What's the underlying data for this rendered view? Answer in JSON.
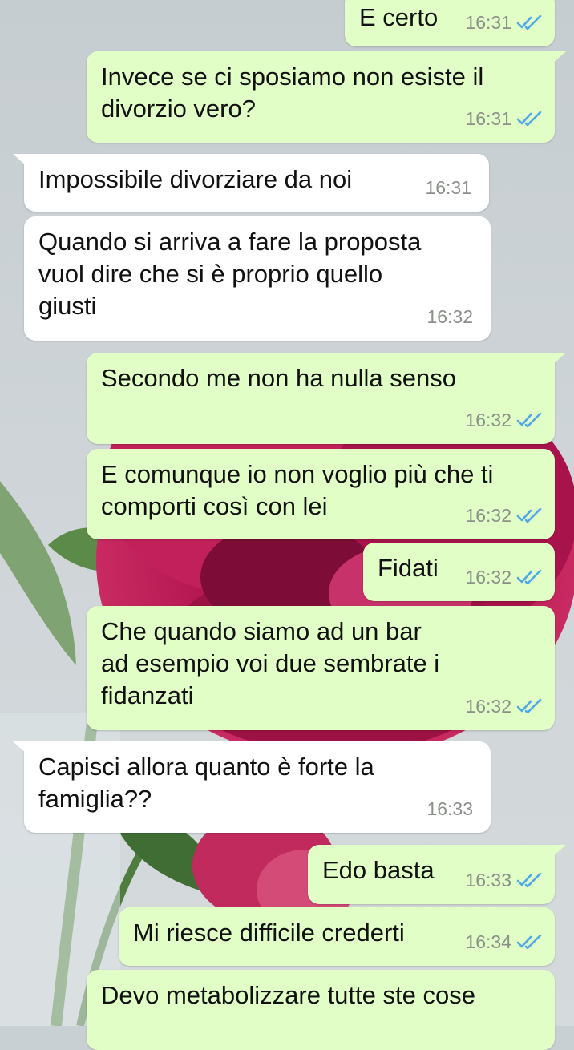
{
  "colors": {
    "outgoing_bubble": "#e1fec6",
    "incoming_bubble": "#ffffff",
    "read_ticks": "#4fa8e8",
    "time_text": "#8a8f8a"
  },
  "icons": {
    "read_receipt": "double-check-icon"
  },
  "messages": [
    {
      "direction": "out",
      "text": "E certo",
      "time": "16:31",
      "read": true
    },
    {
      "direction": "out",
      "text": "Invece se ci sposiamo non esiste il\ndivorzio vero?",
      "time": "16:31",
      "read": true
    },
    {
      "direction": "in",
      "text": "Impossibile divorziare da noi",
      "time": "16:31"
    },
    {
      "direction": "in",
      "text": "Quando si arriva a fare la proposta\nvuol dire che si è proprio quello\ngiusti",
      "time": "16:32"
    },
    {
      "direction": "out",
      "text": "Secondo me non ha nulla senso",
      "time": "16:32",
      "read": true
    },
    {
      "direction": "out",
      "text": "E comunque io non voglio più che ti\ncomporti così con lei",
      "time": "16:32",
      "read": true
    },
    {
      "direction": "out",
      "text": "Fidati",
      "time": "16:32",
      "read": true
    },
    {
      "direction": "out",
      "text": "Che quando siamo ad un bar\nad esempio voi due sembrate i\nfidanzati",
      "time": "16:32",
      "read": true
    },
    {
      "direction": "in",
      "text": "Capisci allora quanto è forte la\nfamiglia??",
      "time": "16:33"
    },
    {
      "direction": "out",
      "text": "Edo basta",
      "time": "16:33",
      "read": true
    },
    {
      "direction": "out",
      "text": "Mi riesce difficile crederti",
      "time": "16:34",
      "read": true
    },
    {
      "direction": "out",
      "text": "Devo metabolizzare tutte ste cose",
      "time": "",
      "read": false
    }
  ]
}
